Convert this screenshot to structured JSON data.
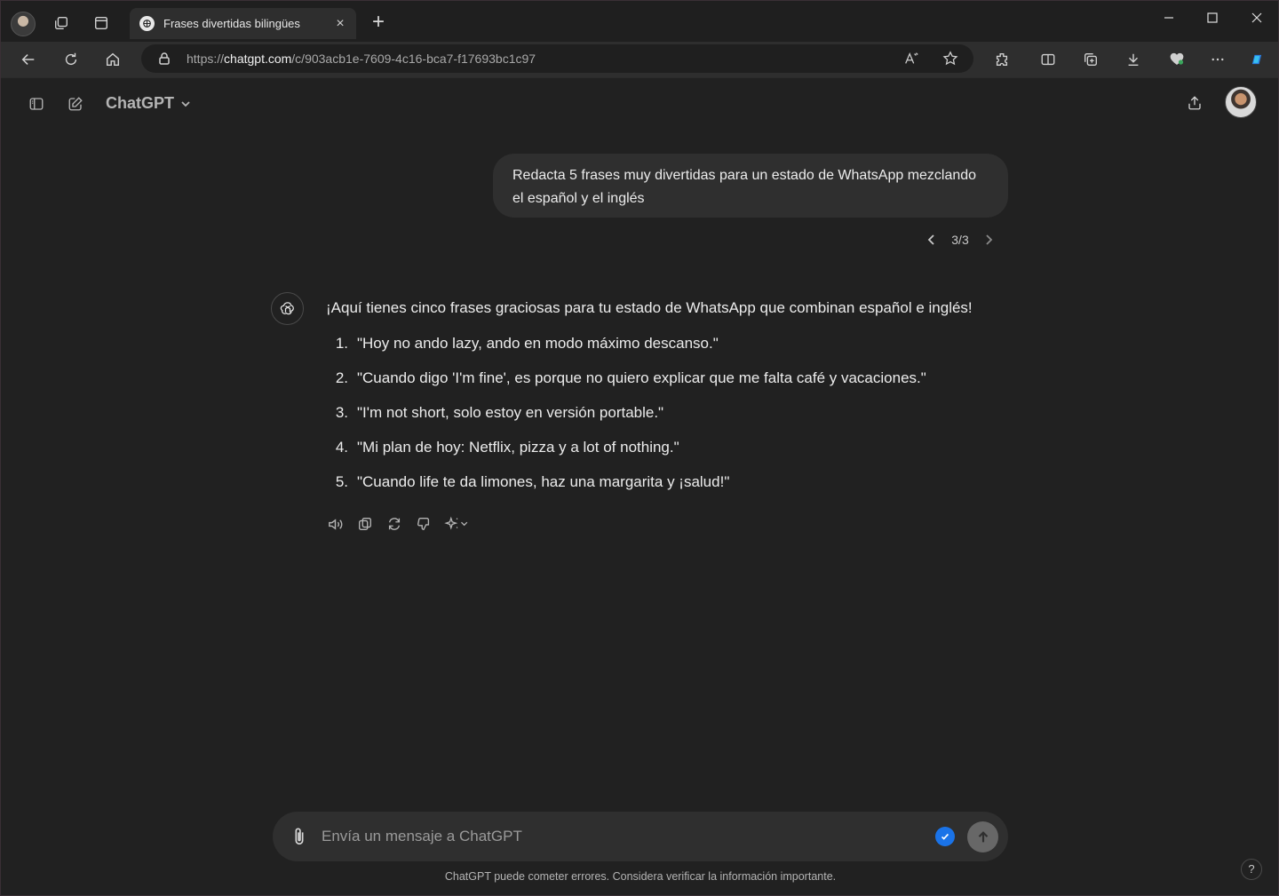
{
  "browser": {
    "tab_title": "Frases divertidas bilingües",
    "new_tab_symbol": "+",
    "url_prefix": "https://",
    "url_host": "chatgpt.com",
    "url_path": "/c/903acb1e-7609-4c16-bca7-f17693bc1c97",
    "window_controls": [
      "minimize",
      "maximize",
      "close"
    ]
  },
  "header": {
    "model_label": "ChatGPT"
  },
  "conversation": {
    "user_message": "Redacta 5 frases muy divertidas para un estado de WhatsApp mezclando el español y el inglés",
    "version_pager": "3/3",
    "assistant_intro": "¡Aquí tienes cinco frases graciosas para tu estado de WhatsApp que combinan español e inglés!",
    "assistant_items": [
      {
        "num": "1.",
        "text": "\"Hoy no ando lazy, ando en modo máximo descanso.\""
      },
      {
        "num": "2.",
        "text": "\"Cuando digo 'I'm fine', es porque no quiero explicar que me falta café y vacaciones.\""
      },
      {
        "num": "3.",
        "text": "\"I'm not short, solo estoy en versión portable.\""
      },
      {
        "num": "4.",
        "text": "\"Mi plan de hoy: Netflix, pizza y a lot of nothing.\""
      },
      {
        "num": "5.",
        "text": "\"Cuando life te da limones, haz una margarita y ¡salud!\""
      }
    ],
    "action_icons": [
      "speaker-icon",
      "copy-icon",
      "regenerate-icon",
      "thumbs-down-icon",
      "sparkle-icon"
    ]
  },
  "composer": {
    "placeholder": "Envía un mensaje a ChatGPT",
    "value": ""
  },
  "footer": {
    "disclaimer": "ChatGPT puede cometer errores. Considera verificar la información importante.",
    "help_label": "?"
  },
  "colors": {
    "page_bg": "#212121",
    "bubble_bg": "#2f2f2f",
    "text": "#ececec",
    "muted": "#b4b4b4",
    "check_blue": "#1a73e8"
  }
}
